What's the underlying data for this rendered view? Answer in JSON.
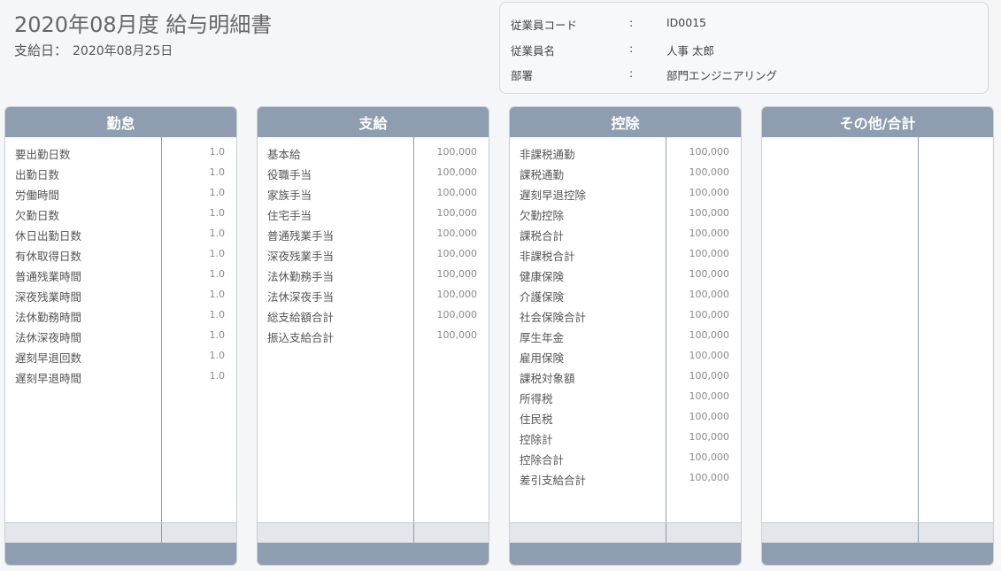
{
  "header": {
    "title": "2020年08月度 給与明細書",
    "paydate_label": "支給日：",
    "paydate_value": "2020年08月25日"
  },
  "employee": [
    {
      "label": "従業員コード",
      "colon": ":",
      "value": "ID0015"
    },
    {
      "label": "従業員名",
      "colon": ":",
      "value": "人事 太郎"
    },
    {
      "label": "部署",
      "colon": ":",
      "value": "部門エンジニアリング"
    }
  ],
  "panels": [
    {
      "title": "勤怠",
      "rows": [
        {
          "label": "要出勤日数",
          "value": "1.0"
        },
        {
          "label": "出勤日数",
          "value": "1.0"
        },
        {
          "label": "労働時間",
          "value": "1.0"
        },
        {
          "label": "欠勤日数",
          "value": "1.0"
        },
        {
          "label": "休日出勤日数",
          "value": "1.0"
        },
        {
          "label": "有休取得日数",
          "value": "1.0"
        },
        {
          "label": "普通残業時間",
          "value": "1.0"
        },
        {
          "label": "深夜残業時間",
          "value": "1.0"
        },
        {
          "label": "法休勤務時間",
          "value": "1.0"
        },
        {
          "label": "法休深夜時間",
          "value": "1.0"
        },
        {
          "label": "遅刻早退回数",
          "value": "1.0"
        },
        {
          "label": "遅刻早退時間",
          "value": "1.0"
        }
      ]
    },
    {
      "title": "支給",
      "rows": [
        {
          "label": "基本給",
          "value": "100,000"
        },
        {
          "label": "役職手当",
          "value": "100,000"
        },
        {
          "label": "家族手当",
          "value": "100,000"
        },
        {
          "label": "住宅手当",
          "value": "100,000"
        },
        {
          "label": "普通残業手当",
          "value": "100,000"
        },
        {
          "label": "深夜残業手当",
          "value": "100,000"
        },
        {
          "label": "法休勤務手当",
          "value": "100,000"
        },
        {
          "label": "法休深夜手当",
          "value": "100,000"
        },
        {
          "label": "総支給額合計",
          "value": "100,000"
        },
        {
          "label": "振込支給合計",
          "value": "100,000"
        }
      ]
    },
    {
      "title": "控除",
      "rows": [
        {
          "label": "非課税通勤",
          "value": "100,000"
        },
        {
          "label": "課税通勤",
          "value": "100,000"
        },
        {
          "label": "遅刻早退控除",
          "value": "100,000"
        },
        {
          "label": "欠勤控除",
          "value": "100,000"
        },
        {
          "label": "課税合計",
          "value": "100,000"
        },
        {
          "label": "非課税合計",
          "value": "100,000"
        },
        {
          "label": "健康保険",
          "value": "100,000"
        },
        {
          "label": "介護保険",
          "value": "100,000"
        },
        {
          "label": "社会保険合計",
          "value": "100,000"
        },
        {
          "label": "厚生年金",
          "value": "100,000"
        },
        {
          "label": "雇用保険",
          "value": "100,000"
        },
        {
          "label": "課税対象額",
          "value": "100,000"
        },
        {
          "label": "所得税",
          "value": "100,000"
        },
        {
          "label": "住民税",
          "value": "100,000"
        },
        {
          "label": "控除計",
          "value": "100,000"
        },
        {
          "label": "控除合計",
          "value": "100,000"
        },
        {
          "label": "差引支給合計",
          "value": "100,000"
        }
      ]
    },
    {
      "title": "その他/合計",
      "rows": []
    }
  ]
}
